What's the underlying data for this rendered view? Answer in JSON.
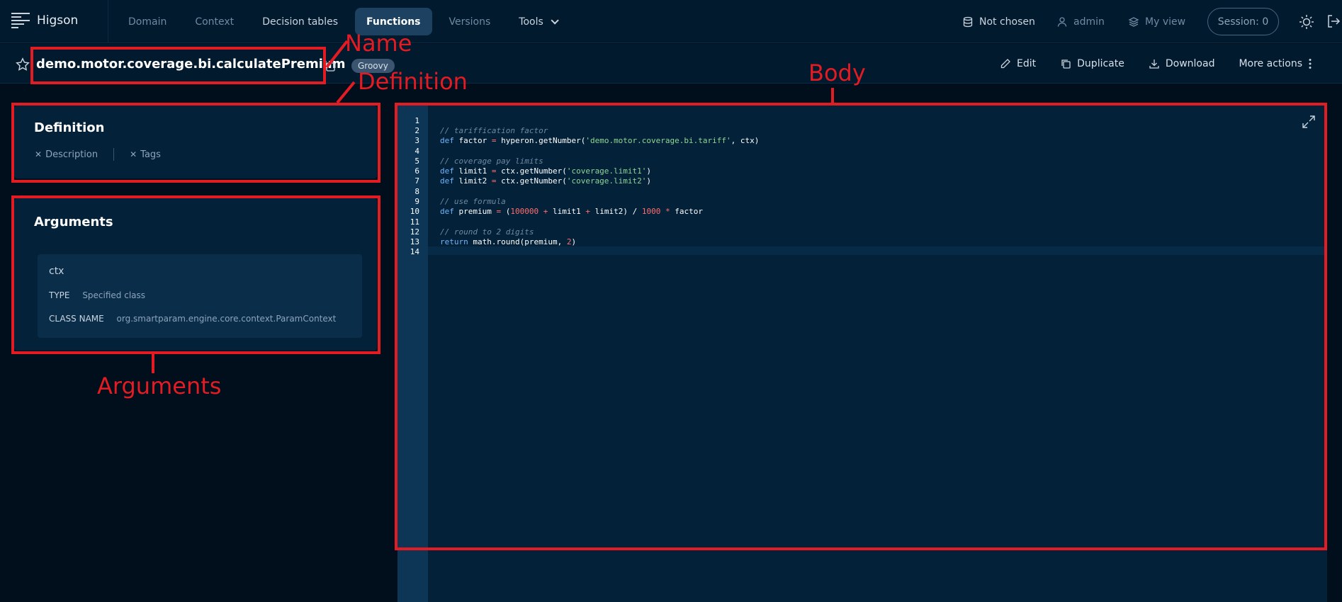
{
  "header": {
    "app_name": "Higson",
    "nav": [
      {
        "label": "Domain"
      },
      {
        "label": "Context"
      },
      {
        "label": "Decision tables"
      },
      {
        "label": "Functions"
      },
      {
        "label": "Versions"
      },
      {
        "label": "Tools"
      }
    ],
    "active_nav": "Functions",
    "environment": "Not chosen",
    "user": "admin",
    "view": "My view",
    "session": "Session: 0"
  },
  "function": {
    "name": "demo.motor.coverage.bi.calculatePremium",
    "language_badge": "Groovy",
    "actions": {
      "edit": "Edit",
      "duplicate": "Duplicate",
      "download": "Download",
      "more": "More actions"
    }
  },
  "definition": {
    "title": "Definition",
    "description_link": "Description",
    "tags_link": "Tags"
  },
  "arguments": {
    "title": "Arguments",
    "items": [
      {
        "name": "ctx",
        "type_label": "TYPE",
        "type_value": "Specified class",
        "class_label": "CLASS NAME",
        "class_value": "org.smartparam.engine.core.context.ParamContext"
      }
    ]
  },
  "editor": {
    "line_numbers": [
      "1",
      "2",
      "3",
      "4",
      "5",
      "6",
      "7",
      "8",
      "9",
      "10",
      "11",
      "12",
      "13",
      "14"
    ]
  },
  "annotations": {
    "name": "Name",
    "definition": "Definition",
    "body": "Body",
    "arguments": "Arguments",
    "color": "#e31b23"
  },
  "icons": [
    "menu-logo-icon",
    "chevron-down-icon",
    "database-icon",
    "user-icon",
    "layers-icon",
    "sun-icon",
    "logout-icon",
    "star-icon",
    "copy-icon",
    "pencil-icon",
    "duplicate-icon",
    "download-icon",
    "more-vertical-icon",
    "close-icon",
    "expand-icon"
  ]
}
